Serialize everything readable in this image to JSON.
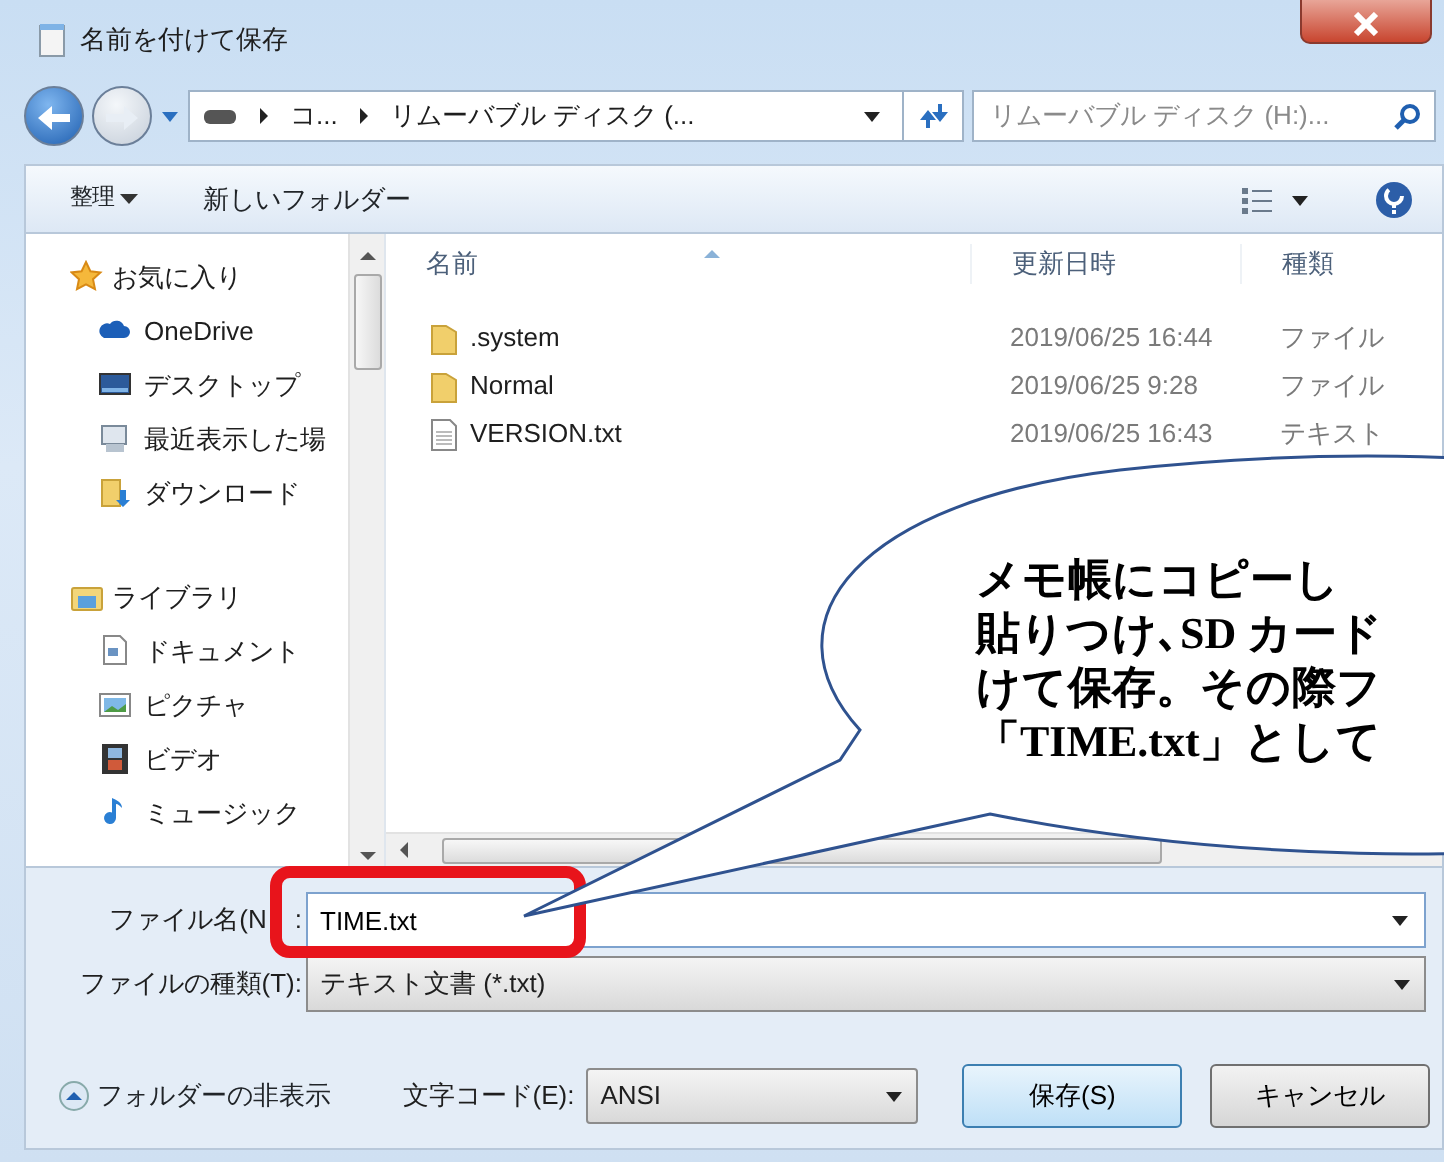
{
  "window": {
    "title": "名前を付けて保存"
  },
  "address": {
    "crumbs": [
      "コ...",
      "リムーバブル ディスク (..."
    ]
  },
  "search": {
    "placeholder": "リムーバブル ディスク (H:)..."
  },
  "toolbar": {
    "organize": "整理",
    "new_folder": "新しいフォルダー"
  },
  "sidebar": {
    "groups": [
      {
        "label": "お気に入り",
        "children": [
          {
            "label": "OneDrive"
          },
          {
            "label": "デスクトップ"
          },
          {
            "label": "最近表示した場"
          },
          {
            "label": "ダウンロード"
          }
        ]
      },
      {
        "label": "ライブラリ",
        "children": [
          {
            "label": "ドキュメント"
          },
          {
            "label": "ピクチャ"
          },
          {
            "label": "ビデオ"
          },
          {
            "label": "ミュージック"
          }
        ]
      }
    ]
  },
  "file_list": {
    "columns": [
      "名前",
      "更新日時",
      "種類"
    ],
    "rows": [
      {
        "name": ".system",
        "kind": "folder",
        "modified": "2019/06/25 16:44",
        "type": "ファイル"
      },
      {
        "name": "Normal",
        "kind": "folder",
        "modified": "2019/06/25 9:28",
        "type": "ファイル"
      },
      {
        "name": "VERSION.txt",
        "kind": "text",
        "modified": "2019/06/25 16:43",
        "type": "テキスト"
      }
    ]
  },
  "file_name": {
    "label": "ファイル名(N",
    "colon": ":",
    "value": "TIME.txt"
  },
  "file_type": {
    "label": "ファイルの種類(T):",
    "value": "テキスト文書 (*.txt)"
  },
  "hide_folders": "フォルダーの非表示",
  "encoding": {
    "label": "文字コード(E):",
    "value": "ANSI"
  },
  "buttons": [
    {
      "label": "保存(S)",
      "default": true
    },
    {
      "label": "キャンセル",
      "default": false
    }
  ],
  "callout": {
    "lines": [
      "メモ帳にコピーし",
      "貼りつけ､SD カード",
      "けて保存。その際フ",
      "「TIME.txt」として"
    ]
  }
}
